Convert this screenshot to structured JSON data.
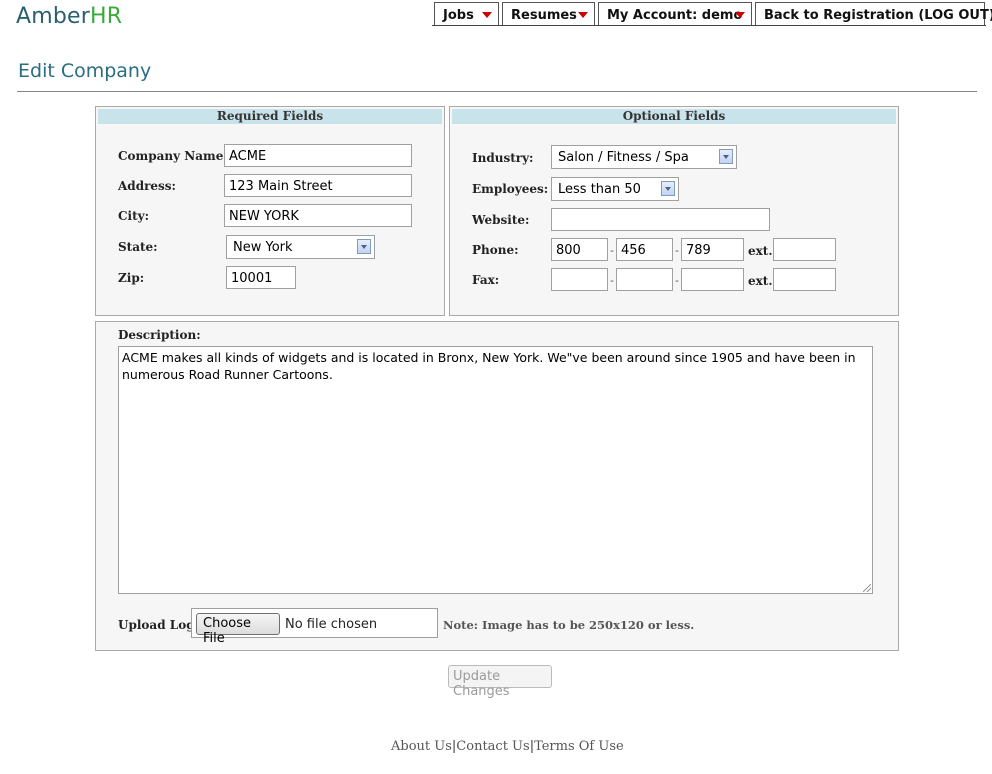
{
  "logo": {
    "part1": "Amber",
    "part2": "HR"
  },
  "nav": {
    "jobs": "Jobs",
    "resumes": "Resumes",
    "account": "My Account: demo",
    "back": "Back to Registration (LOG OUT)"
  },
  "page_title": "Edit Company",
  "required": {
    "header": "Required Fields",
    "company_name_label": "Company Name:",
    "company_name": "ACME",
    "address_label": "Address:",
    "address": "123 Main Street",
    "city_label": "City:",
    "city": "NEW YORK",
    "state_label": "State:",
    "state": "New York",
    "zip_label": "Zip:",
    "zip": "10001"
  },
  "optional": {
    "header": "Optional Fields",
    "industry_label": "Industry:",
    "industry": "Salon / Fitness / Spa",
    "employees_label": "Employees:",
    "employees": "Less than 50",
    "website_label": "Website:",
    "website": "",
    "phone_label": "Phone:",
    "phone": {
      "area": "800",
      "prefix": "456",
      "line": "789",
      "ext": ""
    },
    "fax_label": "Fax:",
    "fax": {
      "area": "",
      "prefix": "",
      "line": "",
      "ext": ""
    },
    "ext_label": "ext.",
    "dash": "-"
  },
  "description": {
    "label": "Description:",
    "text": "ACME makes all kinds of widgets and is located in Bronx, New York. We\"ve been around since 1905 and have been in numerous Road Runner Cartoons."
  },
  "upload": {
    "label": "Upload Logo:",
    "button": "Choose File",
    "status": "No file chosen",
    "note": "Note: Image has to be 250x120 or less."
  },
  "submit": "Update Changes",
  "footer": {
    "about": "About Us",
    "contact": "Contact Us",
    "terms": "Terms Of Use",
    "sep": "|"
  },
  "colors": {
    "brand_teal": "#2b6e80",
    "brand_green": "#3aab3a",
    "panel_header": "#c9e3eb",
    "arrow_red": "#cc0000"
  }
}
